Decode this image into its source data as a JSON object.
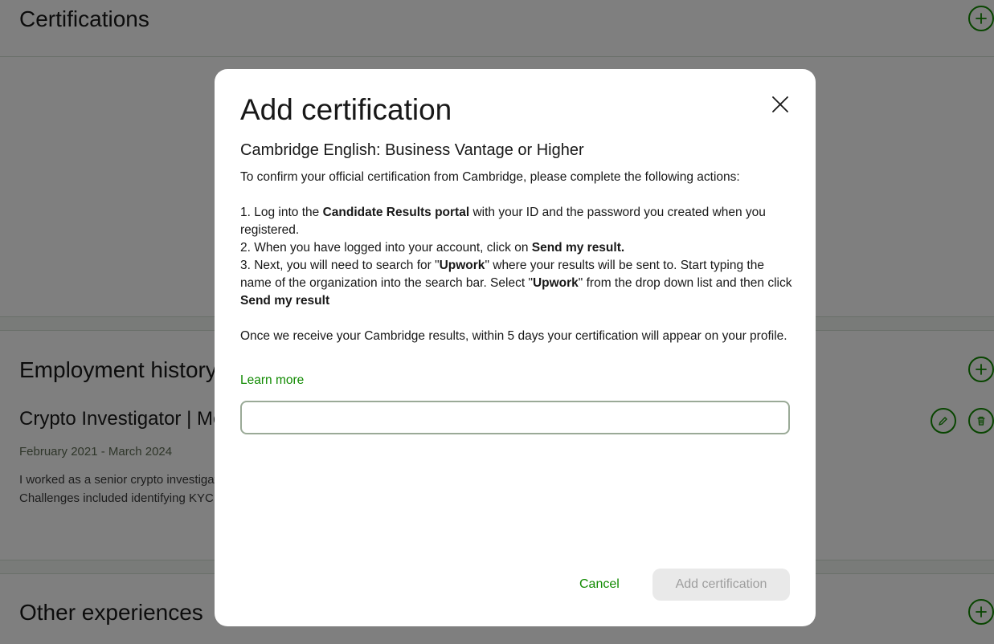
{
  "background": {
    "sections": {
      "certifications": "Certifications",
      "employment": "Employment history",
      "other": "Other experiences"
    },
    "job": {
      "title": "Crypto Investigator | Metamask",
      "dates": "February 2021 - March 2024",
      "desc_line1": "I worked as a senior crypto investigator with a focus on tracing illicit funds across blockchains.",
      "desc_line2": "Challenges included identifying KYC gaps and coordinating with exchanges."
    },
    "icons": {
      "add": "plus-circle-icon",
      "edit": "pencil-icon",
      "delete": "trash-icon"
    }
  },
  "modal": {
    "title": "Add certification",
    "close_icon": "close-icon",
    "cert_name": "Cambridge English: Business Vantage or Higher",
    "intro": "To confirm your official certification from Cambridge, please complete the following actions:",
    "step1_pre": "1. Log into the ",
    "step1_bold": "Candidate Results portal",
    "step1_post": " with your ID and the password you created when you registered.",
    "step2_pre": "2. When you have logged into your account, click on ",
    "step2_bold": "Send my result.",
    "step3_pre": "3. Next, you will need to search for \"",
    "step3_bold1": "Upwork",
    "step3_mid": "\" where your results will be sent to. Start typing the name of the organization into the search bar. Select \"",
    "step3_bold2": "Upwork",
    "step3_mid2": "\" from the drop down list and then click ",
    "step3_bold3": "Send my result",
    "closing": "Once we receive your Cambridge results, within 5 days your certification will appear on your profile.",
    "learn_more": "Learn more",
    "input_value": "",
    "input_placeholder": "",
    "cancel_label": "Cancel",
    "add_label": "Add certification"
  },
  "colors": {
    "accent": "#108a00",
    "overlay": "rgba(0,0,0,0.5)",
    "disabled_bg": "#e9e9e9",
    "disabled_text": "#9e9e9e"
  }
}
